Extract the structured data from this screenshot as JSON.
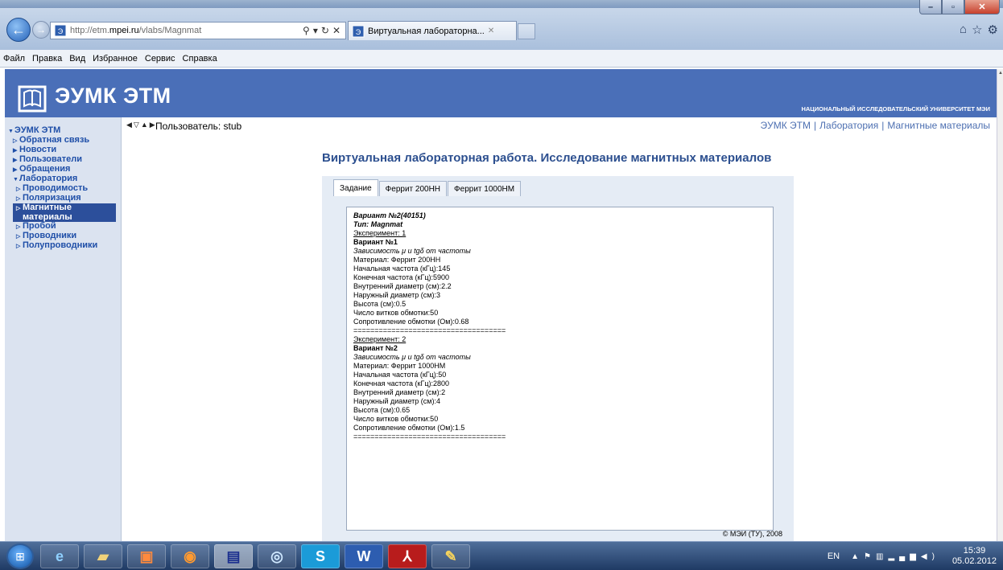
{
  "browser": {
    "url_prefix": "http://etm.",
    "url_domain": "mpei.ru",
    "url_path": "/vlabs/Magnmat",
    "tab_title": "Виртуальная лабораторна...",
    "menu": [
      "Файл",
      "Правка",
      "Вид",
      "Избранное",
      "Сервис",
      "Справка"
    ]
  },
  "site": {
    "title": "ЭУМК ЭТМ",
    "university": "НАЦИОНАЛЬНЫЙ ИССЛЕДОВАТЕЛЬСКИЙ УНИВЕРСИТЕТ МЭИ",
    "user_label": "Пользователь: stub",
    "breadcrumb": [
      "ЭУМК ЭТМ",
      "Лаборатория",
      "Магнитные материалы"
    ]
  },
  "sidebar": {
    "items": [
      {
        "label": "ЭУМК ЭТМ",
        "tri": "▼"
      },
      {
        "label": "Обратная связь",
        "tri": "▷"
      },
      {
        "label": "Новости",
        "tri": "▶"
      },
      {
        "label": "Пользователи",
        "tri": "▶"
      },
      {
        "label": "Обращения",
        "tri": "▶"
      },
      {
        "label": "Лаборатория",
        "tri": "▼"
      },
      {
        "label": "Проводимость",
        "tri": "▷"
      },
      {
        "label": "Поляризация",
        "tri": "▷"
      },
      {
        "label": "Магнитные",
        "tri": "▷"
      },
      {
        "label": "материалы",
        "tri": ""
      },
      {
        "label": "Пробой",
        "tri": "▷"
      },
      {
        "label": "Проводники",
        "tri": "▷"
      },
      {
        "label": "Полупроводники",
        "tri": "▷"
      }
    ]
  },
  "main": {
    "heading": "Виртуальная лабораторная работа. Исследование магнитных материалов",
    "tabs": [
      "Задание",
      "Феррит 200НН",
      "Феррит 1000НМ"
    ],
    "content": [
      "Вариант №2(40151)",
      "Тип: Magnmat",
      "Эксперимент: 1",
      "Вариант №1",
      "Зависимость μ и tgδ от частоты",
      "Материал: Феррит 200НН",
      "Начальная частота (кГц):145",
      "Конечная частота (кГц):5900",
      "Внутренний диаметр (см):2.2",
      "Наружный диаметр (см):3",
      "Высота (см):0.5",
      "Число витков обмотки:50",
      "Сопротивление обмотки (Ом):0.68",
      "====================================",
      "Эксперимент: 2",
      "Вариант №2",
      "Зависимость μ и tgδ от частоты",
      "Материал: Феррит 1000НМ",
      "Начальная частота (кГц):50",
      "Конечная частота (кГц):2800",
      "Внутренний диаметр (см):2",
      "Наружный диаметр (см):4",
      "Высота (см):0.65",
      "Число витков обмотки:50",
      "Сопротивление обмотки (Ом):1.5",
      "===================================="
    ],
    "copyright": "© МЭИ (ТУ), 2008"
  },
  "taskbar": {
    "lang": "EN",
    "time": "15:39",
    "date": "05.02.2012"
  },
  "colors": {
    "header_blue": "#4a6fb8",
    "sidebar_bg": "#dbe3f0",
    "link_blue": "#1f4fa8",
    "selected_bg": "#2c4f9b"
  }
}
